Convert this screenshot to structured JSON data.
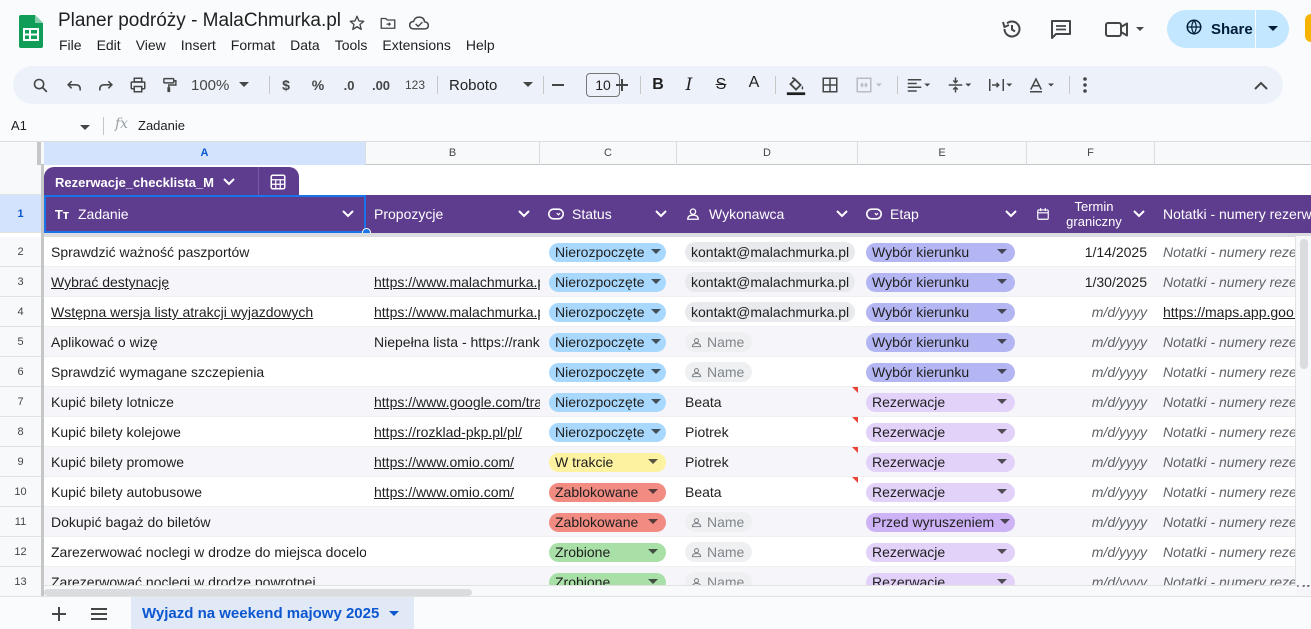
{
  "app": {
    "doc_title": "Planer podróży - MalaChmurka.pl",
    "menu": [
      "File",
      "Edit",
      "View",
      "Insert",
      "Format",
      "Data",
      "Tools",
      "Extensions",
      "Help"
    ],
    "share_label": "Share"
  },
  "toolbar": {
    "zoom": "100%",
    "currency": "$",
    "percent": "%",
    "dec_decrease": ".0",
    "dec_increase": ".00",
    "number_format": "123",
    "font": "Roboto",
    "font_size": "10",
    "bold": "B",
    "italic": "I",
    "strike": "S",
    "text_color": "A"
  },
  "formula_bar": {
    "cell_ref": "A1",
    "fx": "fx",
    "content": "Zadanie"
  },
  "grid": {
    "columns": [
      "A",
      "B",
      "C",
      "D",
      "E",
      "F"
    ],
    "row_numbers": [
      "1",
      "2",
      "3",
      "4",
      "5",
      "6",
      "7",
      "8",
      "9",
      "10",
      "11",
      "12",
      "13"
    ],
    "table_name": "Rezerwacje_checklista_M...",
    "headers": {
      "zadanie": "Zadanie",
      "propozycje": "Propozycje",
      "status": "Status",
      "wykonawca": "Wykonawca",
      "etap": "Etap",
      "termin_1": "Termin",
      "termin_2": "graniczny",
      "notatki": "Notatki - numery rezerwacji"
    },
    "rows": [
      {
        "zadanie": "Sprawdzić ważność paszportów",
        "zadanie_link": false,
        "propozycje": "",
        "propozycje_link": false,
        "status": "Nierozpoczęte",
        "wykonawca": "kontakt@malachmurka.pl",
        "wyk_type": "email",
        "wyk_flag": false,
        "etap": "Wybór kierunku",
        "termin": "1/14/2025",
        "notatki": "Notatki - numery rezerwacji",
        "notatki_link": false
      },
      {
        "zadanie": "Wybrać destynację",
        "zadanie_link": true,
        "propozycje": "https://www.malachmurka.pl",
        "propozycje_link": true,
        "status": "Nierozpoczęte",
        "wykonawca": "kontakt@malachmurka.pl",
        "wyk_type": "email",
        "wyk_flag": false,
        "etap": "Wybór kierunku",
        "termin": "1/30/2025",
        "notatki": "Notatki - numery rezerwacji",
        "notatki_link": false
      },
      {
        "zadanie": "Wstępna wersja listy atrakcji wyjazdowych",
        "zadanie_link": true,
        "propozycje": "https://www.malachmurka.pl",
        "propozycje_link": true,
        "status": "Nierozpoczęte",
        "wykonawca": "kontakt@malachmurka.pl",
        "wyk_type": "email",
        "wyk_flag": false,
        "etap": "Wybór kierunku",
        "termin": "m/d/yyyy",
        "notatki": "https://maps.app.goo.gl",
        "notatki_link": true
      },
      {
        "zadanie": "Aplikować o wizę",
        "zadanie_link": false,
        "propozycje": "Niepełna lista - https://rankomat.pl",
        "propozycje_link": false,
        "status": "Nierozpoczęte",
        "wykonawca": "Name",
        "wyk_type": "placeholder",
        "wyk_flag": false,
        "etap": "Wybór kierunku",
        "termin": "m/d/yyyy",
        "notatki": "Notatki - numery rezerwacji",
        "notatki_link": false
      },
      {
        "zadanie": "Sprawdzić wymagane szczepienia",
        "zadanie_link": false,
        "propozycje": "",
        "propozycje_link": false,
        "status": "Nierozpoczęte",
        "wykonawca": "Name",
        "wyk_type": "placeholder",
        "wyk_flag": false,
        "etap": "Wybór kierunku",
        "termin": "m/d/yyyy",
        "notatki": "Notatki - numery rezerwacji",
        "notatki_link": false
      },
      {
        "zadanie": "Kupić bilety lotnicze",
        "zadanie_link": false,
        "propozycje": "https://www.google.com/travel",
        "propozycje_link": true,
        "status": "Nierozpoczęte",
        "wykonawca": "Beata",
        "wyk_type": "text",
        "wyk_flag": true,
        "etap": "Rezerwacje",
        "termin": "m/d/yyyy",
        "notatki": "Notatki - numery rezerwacji",
        "notatki_link": false
      },
      {
        "zadanie": "Kupić bilety kolejowe",
        "zadanie_link": false,
        "propozycje": "https://rozklad-pkp.pl/pl/",
        "propozycje_link": true,
        "status": "Nierozpoczęte",
        "wykonawca": "Piotrek",
        "wyk_type": "text",
        "wyk_flag": true,
        "etap": "Rezerwacje",
        "termin": "m/d/yyyy",
        "notatki": "Notatki - numery rezerwacji",
        "notatki_link": false
      },
      {
        "zadanie": "Kupić bilety promowe",
        "zadanie_link": false,
        "propozycje": "https://www.omio.com/",
        "propozycje_link": true,
        "status": "W trakcie",
        "wykonawca": "Piotrek",
        "wyk_type": "text",
        "wyk_flag": true,
        "etap": "Rezerwacje",
        "termin": "m/d/yyyy",
        "notatki": "Notatki - numery rezerwacji",
        "notatki_link": false
      },
      {
        "zadanie": "Kupić bilety autobusowe",
        "zadanie_link": false,
        "propozycje": "https://www.omio.com/",
        "propozycje_link": true,
        "status": "Zablokowane",
        "wykonawca": "Beata",
        "wyk_type": "text",
        "wyk_flag": true,
        "etap": "Rezerwacje",
        "termin": "m/d/yyyy",
        "notatki": "Notatki - numery rezerwacji",
        "notatki_link": false
      },
      {
        "zadanie": "Dokupić bagaż do biletów",
        "zadanie_link": false,
        "propozycje": "",
        "propozycje_link": false,
        "status": "Zablokowane",
        "wykonawca": "Name",
        "wyk_type": "placeholder",
        "wyk_flag": false,
        "etap": "Przed wyruszeniem",
        "termin": "m/d/yyyy",
        "notatki": "Notatki - numery rezerwacji",
        "notatki_link": false
      },
      {
        "zadanie": "Zarezerwować noclegi w drodze do miejsca docelowego",
        "zadanie_link": false,
        "propozycje": "",
        "propozycje_link": false,
        "status": "Zrobione",
        "wykonawca": "Name",
        "wyk_type": "placeholder",
        "wyk_flag": false,
        "etap": "Rezerwacje",
        "termin": "m/d/yyyy",
        "notatki": "Notatki - numery rezerwacji",
        "notatki_link": false
      },
      {
        "zadanie": "Zarezerwować noclegi w drodze powrotnej",
        "zadanie_link": false,
        "propozycje": "",
        "propozycje_link": false,
        "status": "Zrobione",
        "wykonawca": "Name",
        "wyk_type": "placeholder",
        "wyk_flag": false,
        "etap": "Rezerwacje",
        "termin": "m/d/yyyy",
        "notatki": "Notatki - numery rezerwacji",
        "notatki_link": false
      }
    ]
  },
  "status_colors": {
    "Nierozpoczęte": "#a8d8fd",
    "W trakcie": "#fdf2a0",
    "Zablokowane": "#f28b82",
    "Zrobione": "#a8e0a8"
  },
  "etap_colors": {
    "Wybór kierunku": "#b4b6f3",
    "Rezerwacje": "#e2d1f9",
    "Przed wyruszeniem": "#cdb3f5"
  },
  "colors": {
    "header_purple": "#5e3d8f",
    "selection_blue": "#1a73e8",
    "share_bg": "#c2e7ff"
  },
  "sheets": {
    "active": "Wyjazd na weekend majowy 2025"
  }
}
